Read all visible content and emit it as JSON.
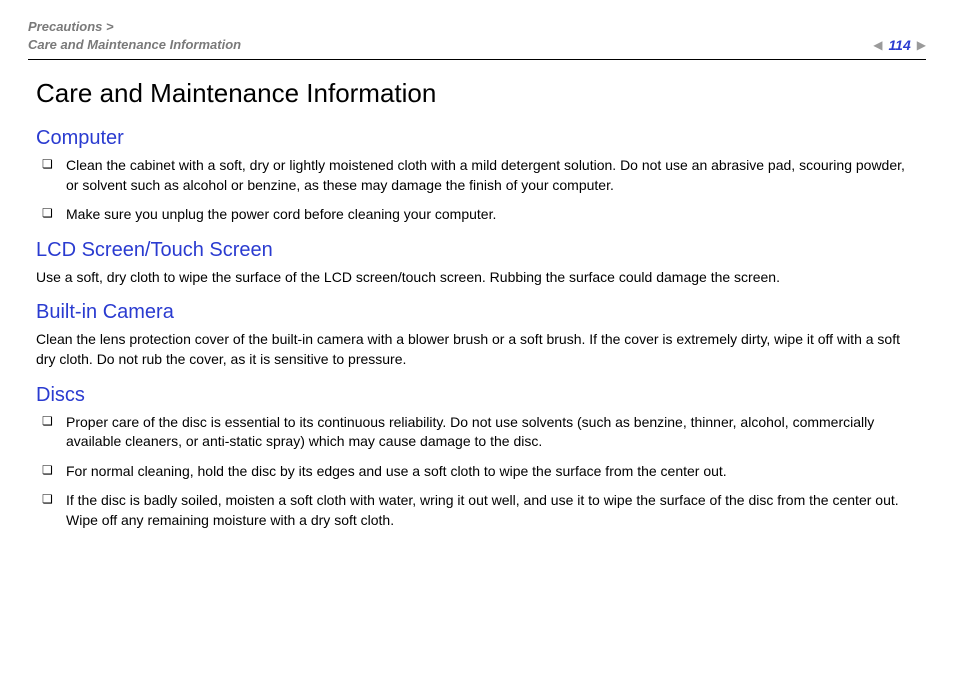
{
  "header": {
    "breadcrumb_line1": "Precautions >",
    "breadcrumb_line2": "Care and Maintenance Information",
    "page_number": "114"
  },
  "title": "Care and Maintenance Information",
  "sections": {
    "computer": {
      "heading": "Computer",
      "items": [
        "Clean the cabinet with a soft, dry or lightly moistened cloth with a mild detergent solution. Do not use an abrasive pad, scouring powder, or solvent such as alcohol or benzine, as these may damage the finish of your computer.",
        "Make sure you unplug the power cord before cleaning your computer."
      ]
    },
    "lcd": {
      "heading": "LCD Screen/Touch Screen",
      "para": "Use a soft, dry cloth to wipe the surface of the LCD screen/touch screen. Rubbing the surface could damage the screen."
    },
    "camera": {
      "heading": "Built-in Camera",
      "para": "Clean the lens protection cover of the built-in camera with a blower brush or a soft brush. If the cover is extremely dirty, wipe it off with a soft dry cloth. Do not rub the cover, as it is sensitive to pressure."
    },
    "discs": {
      "heading": "Discs",
      "items": [
        "Proper care of the disc is essential to its continuous reliability. Do not use solvents (such as benzine, thinner, alcohol, commercially available cleaners, or anti-static spray) which may cause damage to the disc.",
        "For normal cleaning, hold the disc by its edges and use a soft cloth to wipe the surface from the center out.",
        "If the disc is badly soiled, moisten a soft cloth with water, wring it out well, and use it to wipe the surface of the disc from the center out. Wipe off any remaining moisture with a dry soft cloth."
      ]
    }
  }
}
